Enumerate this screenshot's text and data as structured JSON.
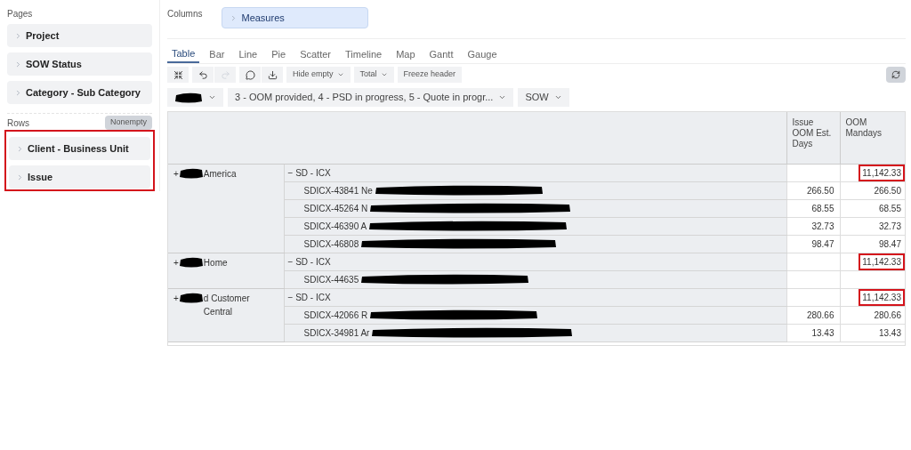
{
  "sidebar": {
    "pages": {
      "label": "Pages",
      "items": [
        "Project",
        "SOW Status",
        "Category - Sub Category"
      ]
    },
    "rows": {
      "label": "Rows",
      "button": "Nonempty",
      "highlighted": true,
      "items": [
        "Client - Business Unit",
        "Issue"
      ]
    }
  },
  "columns": {
    "label": "Columns",
    "items": [
      "Measures"
    ]
  },
  "tabs": [
    {
      "label": "Table",
      "selected": true
    },
    {
      "label": "Bar",
      "selected": false
    },
    {
      "label": "Line",
      "selected": false
    },
    {
      "label": "Pie",
      "selected": false
    },
    {
      "label": "Scatter",
      "selected": false
    },
    {
      "label": "Timeline",
      "selected": false
    },
    {
      "label": "Map",
      "selected": false
    },
    {
      "label": "Gantt",
      "selected": false
    },
    {
      "label": "Gauge",
      "selected": false
    }
  ],
  "toolbar": {
    "dropdowns": [
      "Hide empty",
      "Total"
    ],
    "button": "Freeze header"
  },
  "filters": [
    {
      "redacted": true
    },
    {
      "label": "3 - OOM provided, 4 - PSD in progress, 5 - Quote in progr...",
      "redacted": false
    },
    {
      "label": "SOW",
      "redacted": false
    }
  ],
  "table": {
    "columns": [
      "Issue OOM Est. Days",
      "OOM Mandays"
    ],
    "groups": [
      {
        "client": {
          "toggle": "+",
          "name": "America"
        },
        "subgroup": {
          "toggle": "−",
          "name": "SD - ICX",
          "oom_mandays": "11,142.33",
          "highlighted": true
        },
        "rows": [
          {
            "issue": "SDICX-43841 Ne",
            "est_days": "266.50",
            "oom_mandays": "266.50"
          },
          {
            "issue": "SDICX-45264 N",
            "est_days": "68.55",
            "oom_mandays": "68.55"
          },
          {
            "issue": "SDICX-46390 A",
            "est_days": "32.73",
            "oom_mandays": "32.73"
          },
          {
            "issue": "SDICX-46808",
            "est_days": "98.47",
            "oom_mandays": "98.47"
          }
        ]
      },
      {
        "client": {
          "toggle": "+",
          "name": "Home"
        },
        "subgroup": {
          "toggle": "−",
          "name": "SD - ICX",
          "oom_mandays": "11,142.33",
          "highlighted": true
        },
        "rows": [
          {
            "issue": "SDICX-44635"
          }
        ]
      },
      {
        "client": {
          "toggle": "+",
          "name": "d Customer Central"
        },
        "subgroup": {
          "toggle": "−",
          "name": "SD - ICX",
          "oom_mandays": "11,142.33",
          "highlighted": true
        },
        "rows": [
          {
            "issue": "SDICX-42066 R",
            "est_days": "280.66",
            "oom_mandays": "280.66"
          },
          {
            "issue": "SDICX-34981 Ar",
            "est_days": "13.43",
            "oom_mandays": "13.43"
          }
        ]
      }
    ]
  }
}
